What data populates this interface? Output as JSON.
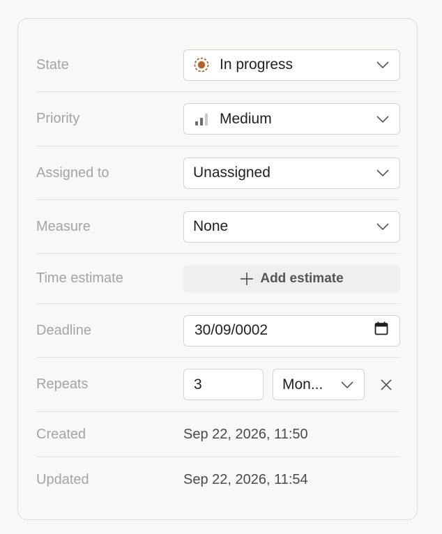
{
  "fields": {
    "state": {
      "label": "State",
      "value": "In progress",
      "icon": "in-progress-icon",
      "icon_color": "#b5622a"
    },
    "priority": {
      "label": "Priority",
      "value": "Medium",
      "icon": "priority-bars-icon"
    },
    "assigned": {
      "label": "Assigned to",
      "value": "Unassigned"
    },
    "measure": {
      "label": "Measure",
      "value": "None"
    },
    "time_estimate": {
      "label": "Time estimate",
      "button": "Add estimate"
    },
    "deadline": {
      "label": "Deadline",
      "value": "30/09/0002"
    },
    "repeats": {
      "label": "Repeats",
      "count": "3",
      "unit": "Mon..."
    },
    "created": {
      "label": "Created",
      "value": "Sep 22, 2026, 11:50"
    },
    "updated": {
      "label": "Updated",
      "value": "Sep 22, 2026, 11:54"
    }
  }
}
